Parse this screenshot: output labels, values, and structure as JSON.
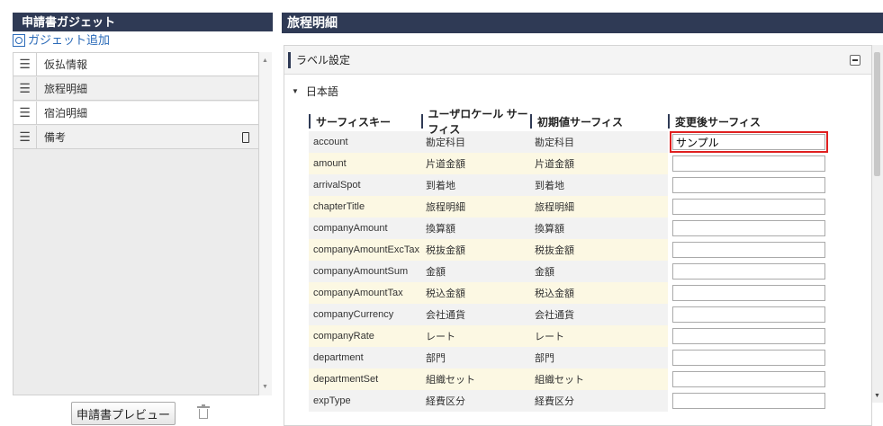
{
  "left_panel": {
    "title": "申請書ガジェット",
    "add_link": "ガジェット追加",
    "items": [
      {
        "label": "仮払情報"
      },
      {
        "label": "旅程明細"
      },
      {
        "label": "宿泊明細"
      },
      {
        "label": "備考"
      }
    ],
    "preview_button": "申請書プレビュー"
  },
  "right_panel": {
    "title": "旅程明細",
    "label_settings": "ラベル設定",
    "language": "日本語",
    "columns": [
      "サーフィスキー",
      "ユーザロケール サーフィス",
      "初期値サーフィス",
      "変更後サーフィス"
    ],
    "rows": [
      {
        "key": "account",
        "user": "勘定科目",
        "initial": "勘定科目",
        "changed": "サンプル"
      },
      {
        "key": "amount",
        "user": "片道金額",
        "initial": "片道金額",
        "changed": ""
      },
      {
        "key": "arrivalSpot",
        "user": "到着地",
        "initial": "到着地",
        "changed": ""
      },
      {
        "key": "chapterTitle",
        "user": "旅程明細",
        "initial": "旅程明細",
        "changed": ""
      },
      {
        "key": "companyAmount",
        "user": "換算額",
        "initial": "換算額",
        "changed": ""
      },
      {
        "key": "companyAmountExcTax",
        "user": "税抜金額",
        "initial": "税抜金額",
        "changed": ""
      },
      {
        "key": "companyAmountSum",
        "user": "金額",
        "initial": "金額",
        "changed": ""
      },
      {
        "key": "companyAmountTax",
        "user": "税込金額",
        "initial": "税込金額",
        "changed": ""
      },
      {
        "key": "companyCurrency",
        "user": "会社通貨",
        "initial": "会社通貨",
        "changed": ""
      },
      {
        "key": "companyRate",
        "user": "レート",
        "initial": "レート",
        "changed": ""
      },
      {
        "key": "department",
        "user": "部門",
        "initial": "部門",
        "changed": ""
      },
      {
        "key": "departmentSet",
        "user": "組織セット",
        "initial": "組織セット",
        "changed": ""
      },
      {
        "key": "expType",
        "user": "経費区分",
        "initial": "経費区分",
        "changed": ""
      }
    ]
  },
  "colors": {
    "header_bg": "#2f3a55",
    "row_highlight": "#fcf8e3",
    "row_plain": "#f2f2f2",
    "highlight_box": "#e02020",
    "link": "#2a6ab8"
  }
}
